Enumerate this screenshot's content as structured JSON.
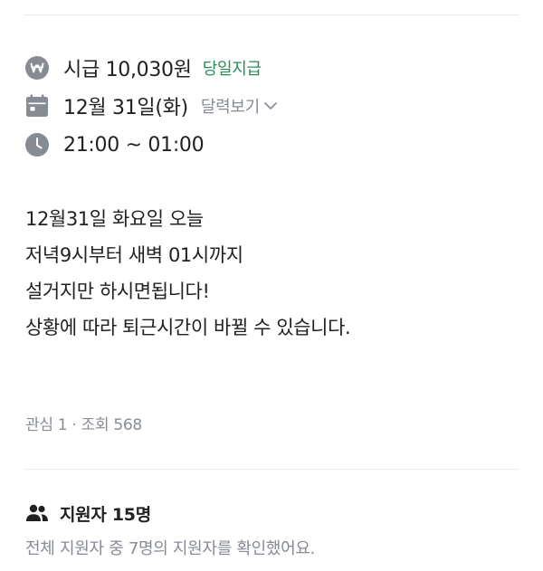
{
  "job": {
    "wage_text": "시급 10,030원",
    "pay_tag": "당일지급",
    "date_text": "12월 31일(화)",
    "calendar_link": "달력보기",
    "time_text": "21:00 ~ 01:00"
  },
  "description_lines": [
    "12월31일 화요일 오늘",
    "저녁9시부터 새벽 01시까지",
    "설거지만 하시면됩니다!",
    "상황에 따라 퇴근시간이 바뀔 수 있습니다."
  ],
  "stats_text": "관심 1 · 조회 568",
  "applicants": {
    "title": "지원자 15명",
    "subtitle": "전체 지원자 중 7명의 지원자를 확인했어요."
  },
  "colors": {
    "icon_gray": "#868b94",
    "text": "#212124",
    "pay_green": "#2b8a57",
    "muted": "#868b94",
    "divider": "#eaebee"
  },
  "icons": {
    "wage": "won-circle-icon",
    "date": "calendar-icon",
    "time": "clock-icon",
    "calendar_toggle": "chevron-down-icon",
    "applicants": "people-icon"
  }
}
